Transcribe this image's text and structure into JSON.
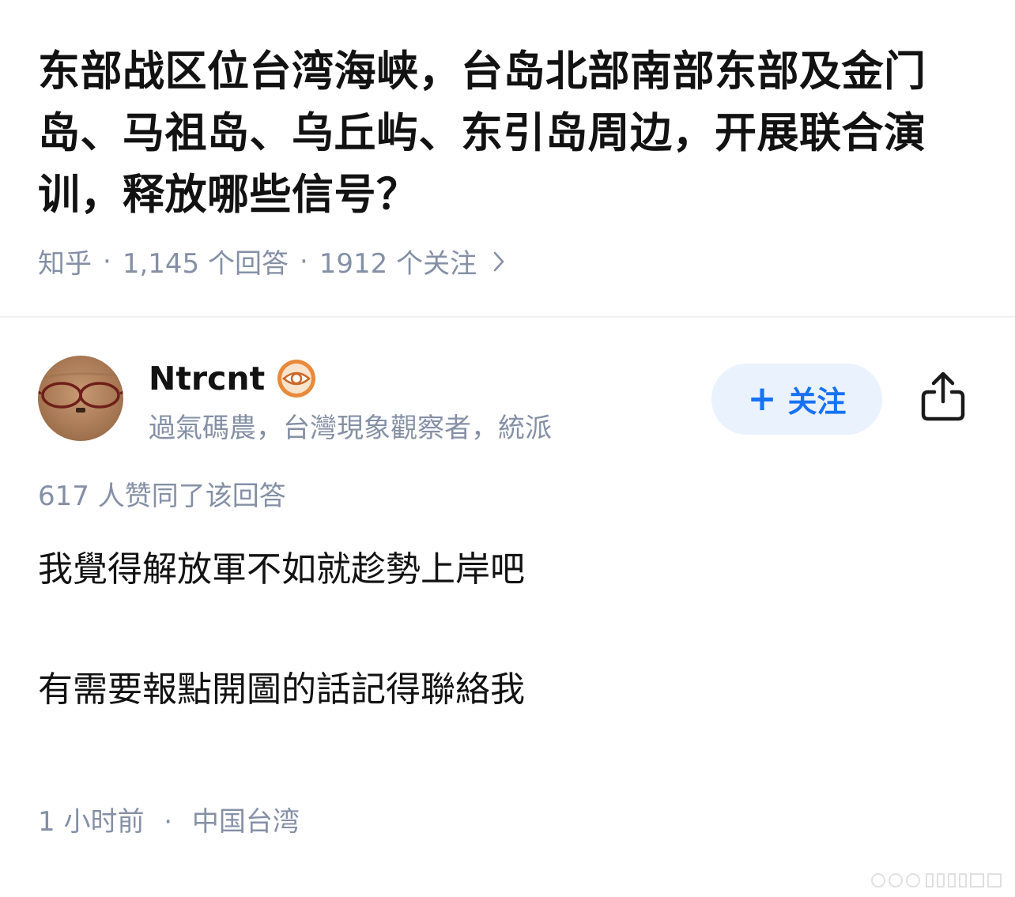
{
  "question": {
    "title": "东部战区位台湾海峡，台岛北部南部东部及金门岛、马祖岛、乌丘屿、东引岛周边，开展联合演训，释放哪些信号？",
    "source": "知乎",
    "answer_count": "1,145 个回答",
    "follower_count": "1912 个关注",
    "separator": "·"
  },
  "author": {
    "name": "Ntrcnt",
    "bio": "過氣碼農，台灣現象觀察者，統派",
    "avatar_icon": "glasses-photo-avatar",
    "badge_icon": "eye-badge-icon",
    "follow_plus": "+",
    "follow_label": "关注",
    "share_icon": "share-icon"
  },
  "answer": {
    "votes": "617 人赞同了该回答",
    "paragraphs": [
      "我覺得解放軍不如就趁勢上岸吧",
      "有需要報點開圖的話記得聯絡我"
    ]
  },
  "footer": {
    "time": "1 小时前",
    "location": "中国台湾",
    "separator": "·"
  },
  "colors": {
    "text_primary": "#121212",
    "text_secondary": "#8590a6",
    "accent": "#1772f6",
    "follow_bg": "#eaf2fd",
    "badge": "#e88a3c"
  }
}
